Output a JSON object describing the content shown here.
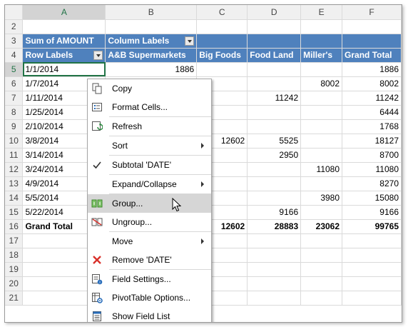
{
  "columns": [
    "A",
    "B",
    "C",
    "D",
    "E",
    "F"
  ],
  "row_numbers": [
    "2",
    "3",
    "4",
    "5",
    "6",
    "7",
    "8",
    "9",
    "10",
    "11",
    "12",
    "13",
    "14",
    "15",
    "16",
    "17",
    "18",
    "19",
    "20",
    "21"
  ],
  "pivot": {
    "sum_label": "Sum of AMOUNT",
    "column_labels": "Column Labels",
    "row_labels": "Row Labels",
    "stores": [
      "A&B Supermarkets",
      "Big Foods",
      "Food Land",
      "Miller's",
      "Grand Total"
    ],
    "rows": [
      {
        "date": "1/1/2014",
        "ab": "1886",
        "big": "",
        "food": "",
        "miller": "",
        "total": "1886"
      },
      {
        "date": "1/7/2014",
        "ab": "",
        "big": "",
        "food": "",
        "miller": "8002",
        "total": "8002"
      },
      {
        "date": "1/11/2014",
        "ab": "",
        "big": "",
        "food": "11242",
        "miller": "",
        "total": "11242"
      },
      {
        "date": "1/25/2014",
        "ab": "",
        "big": "",
        "food": "",
        "miller": "",
        "total": "6444"
      },
      {
        "date": "2/10/2014",
        "ab": "",
        "big": "",
        "food": "",
        "miller": "",
        "total": "1768"
      },
      {
        "date": "3/8/2014",
        "ab": "",
        "big": "12602",
        "food": "5525",
        "miller": "",
        "total": "18127"
      },
      {
        "date": "3/14/2014",
        "ab": "",
        "big": "",
        "food": "2950",
        "miller": "",
        "total": "8700"
      },
      {
        "date": "3/24/2014",
        "ab": "",
        "big": "",
        "food": "",
        "miller": "11080",
        "total": "11080"
      },
      {
        "date": "4/9/2014",
        "ab": "",
        "big": "",
        "food": "",
        "miller": "",
        "total": "8270"
      },
      {
        "date": "5/5/2014",
        "ab": "",
        "big": "",
        "food": "",
        "miller": "3980",
        "total": "15080"
      },
      {
        "date": "5/22/2014",
        "ab": "",
        "big": "",
        "food": "9166",
        "miller": "",
        "total": "9166"
      }
    ],
    "grand_total": {
      "label": "Grand Total",
      "ab": "",
      "big": "12602",
      "food": "28883",
      "miller": "23062",
      "total": "99765"
    }
  },
  "context_menu": {
    "items": [
      {
        "label": "Copy",
        "icon": "copy-icon"
      },
      {
        "label": "Format Cells...",
        "icon": "format-cells-icon"
      },
      {
        "label": "Refresh",
        "icon": "refresh-icon"
      },
      {
        "label": "Sort",
        "icon": ""
      },
      {
        "label": "Subtotal 'DATE'",
        "icon": "checkmark-icon"
      },
      {
        "label": "Expand/Collapse",
        "icon": ""
      },
      {
        "label": "Group...",
        "icon": "group-icon"
      },
      {
        "label": "Ungroup...",
        "icon": "ungroup-icon"
      },
      {
        "label": "Move",
        "icon": ""
      },
      {
        "label": "Remove 'DATE'",
        "icon": "remove-icon"
      },
      {
        "label": "Field Settings...",
        "icon": "field-settings-icon"
      },
      {
        "label": "PivotTable Options...",
        "icon": "pivot-options-icon"
      },
      {
        "label": "Show Field List",
        "icon": "field-list-icon"
      }
    ]
  },
  "colors": {
    "pivot_header": "#4f81bd",
    "selection": "#217346",
    "hover": "#d6d6d6",
    "remove_red": "#d9312b"
  }
}
